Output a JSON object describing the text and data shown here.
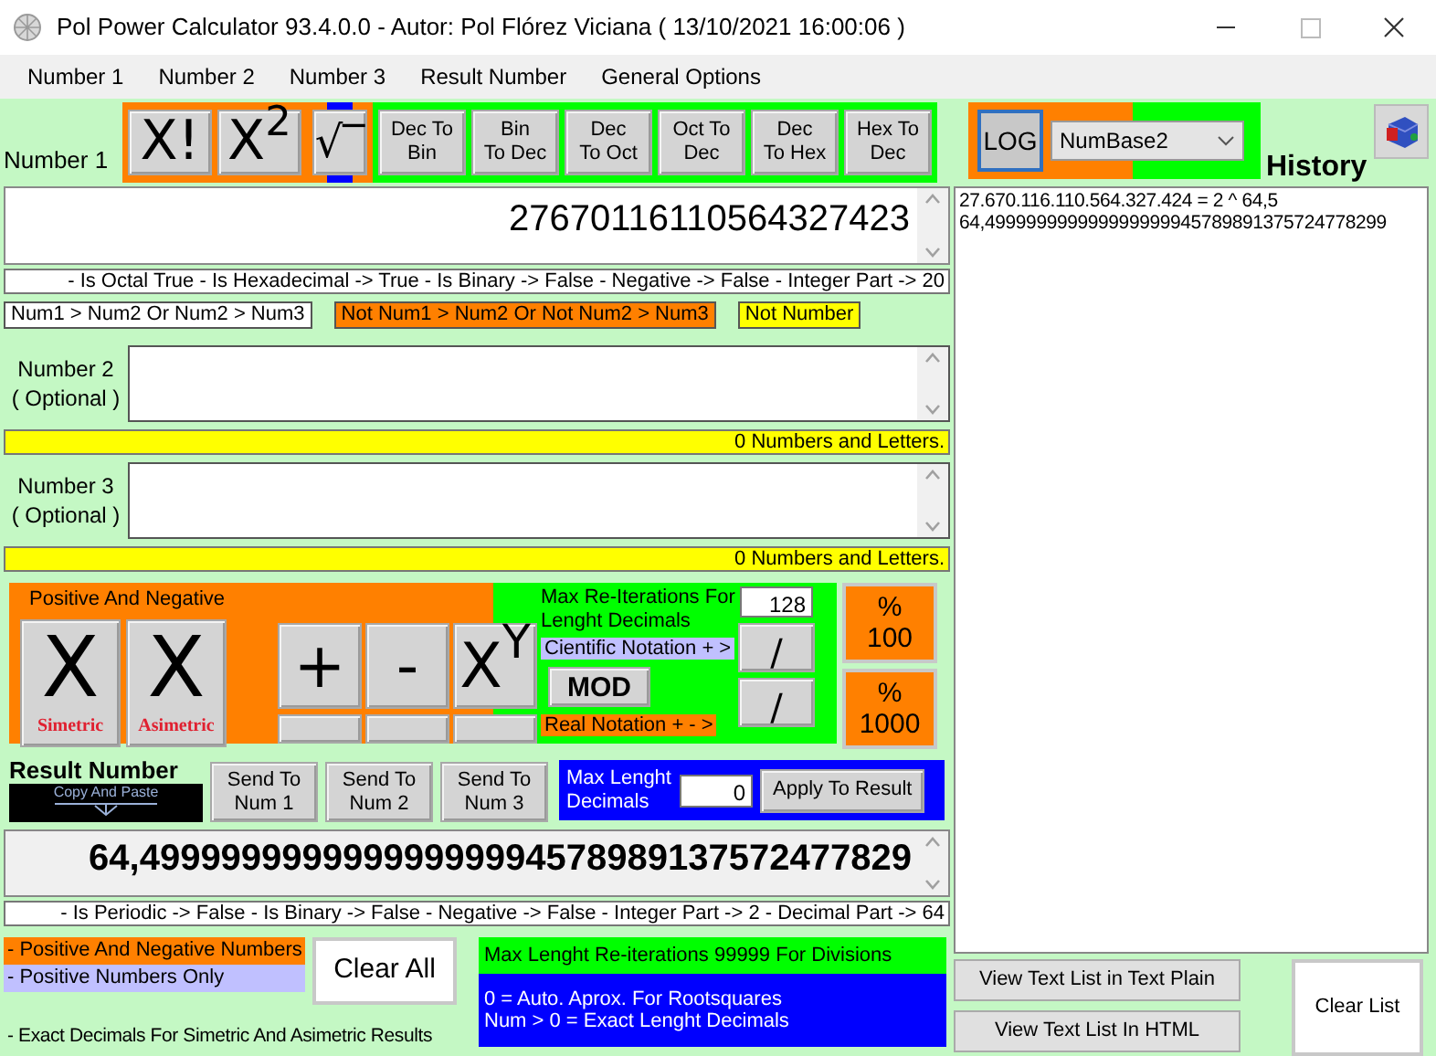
{
  "window": {
    "title": "Pol Power Calculator 93.4.0.0 - Autor: Pol Flórez Viciana ( 13/10/2021 16:00:06 )"
  },
  "menu": [
    "Number 1",
    "Number 2",
    "Number 3",
    "Result Number",
    "General Options"
  ],
  "number1": {
    "label": "Number 1",
    "tool_groups": [
      {
        "color": "#ff8000",
        "marked": false,
        "buttons": [
          {
            "kind": "glyph",
            "text": "X!"
          },
          {
            "kind": "glyph",
            "text": "X$^{2}$"
          }
        ]
      },
      {
        "color": "#ff8000",
        "marked": true,
        "buttons": [
          {
            "kind": "glyph",
            "text": "√‾"
          }
        ]
      },
      {
        "color": "#00ff00",
        "marked": false,
        "buttons": [
          {
            "kind": "text",
            "lines": [
              "Dec To",
              "Bin"
            ]
          },
          {
            "kind": "text",
            "lines": [
              "Bin",
              "To Dec"
            ]
          },
          {
            "kind": "text",
            "lines": [
              "Dec",
              "To Oct"
            ]
          },
          {
            "kind": "text",
            "lines": [
              "Oct To",
              "Dec"
            ]
          },
          {
            "kind": "text",
            "lines": [
              "Dec",
              "To Hex"
            ]
          },
          {
            "kind": "text",
            "lines": [
              "Hex To",
              "Dec"
            ]
          }
        ]
      }
    ],
    "value": "27670116110564327423",
    "info": "- Is Octal True - Is Hexadecimal -> True - Is Binary -> False - Negative -> False - Integer Part -> 20"
  },
  "comparison_legend": [
    {
      "text": "Num1 > Num2 Or Num2 > Num3",
      "color": "#ffffff"
    },
    {
      "text": "Not Num1 > Num2 Or Not Num2 > Num3",
      "color": "#ff8000"
    },
    {
      "text": "Not Number",
      "color": "#ffff00"
    }
  ],
  "number2": {
    "label_lines": [
      "Number 2",
      "( Optional )"
    ],
    "count": "0 Numbers and Letters."
  },
  "number3": {
    "label_lines": [
      "Number 3",
      "( Optional )"
    ],
    "count": "0 Numbers and Letters."
  },
  "sign_modes": {
    "title": "Positive And Negative",
    "buttons": [
      {
        "symbol": "X",
        "caption": "Simetric"
      },
      {
        "symbol": "X",
        "caption": "Asimetric"
      }
    ]
  },
  "operators": [
    "+",
    "-",
    "X$^{Y}$"
  ],
  "reiterations": {
    "label": "Max Re-Iterations For Lenght Decimals",
    "value": "128"
  },
  "cientific_label": "Cientific Notation + >",
  "mod": "MOD",
  "real_label": "Real Notation + - >",
  "divide_buttons": [
    "/",
    "/"
  ],
  "percent_buttons": [
    {
      "lines": [
        "%",
        "100"
      ]
    },
    {
      "lines": [
        "%",
        "1000"
      ]
    }
  ],
  "result": {
    "title": "Result Number",
    "copy": "Copy And Paste",
    "send": [
      {
        "lines": [
          "Send To",
          "Num 1"
        ]
      },
      {
        "lines": [
          "Send To",
          "Num 2"
        ]
      },
      {
        "lines": [
          "Send To",
          "Num 3"
        ]
      }
    ],
    "max_decimals": {
      "label": "Max Lenght Decimals",
      "value": "0",
      "apply": "Apply To Result"
    },
    "value": "64,49999999999999999994578989137572477829",
    "info": "- Is Periodic -> False - Is Binary -> False - Negative -> False - Integer Part -> 2 - Decimal Part -> 64"
  },
  "mode_legend": [
    {
      "text": "- Positive And Negative Numbers",
      "color": "#ff8000"
    },
    {
      "text": "- Positive Numbers Only",
      "color": "#c0c0ff"
    }
  ],
  "clear_all": "Clear All",
  "note": "- Exact Decimals For Simetric And Asimetric Results",
  "hint_green": "Max Lenght Re-iterations 99999 For Divisions",
  "hint_blue": [
    "0 = Auto. Aprox. For Rootsquares",
    "Num > 0 = Exact Lenght Decimals"
  ],
  "log": "LOG",
  "base_select": "NumBase2",
  "history": {
    "title": "History",
    "lines": [
      "27.670.116.110.564.327.424 = 2 ^ 64,5",
      "64,499999999999999999945789891375724778299"
    ]
  },
  "history_buttons": [
    "View Text List in Text Plain",
    "View Text List In HTML"
  ],
  "clear_list": "Clear List"
}
